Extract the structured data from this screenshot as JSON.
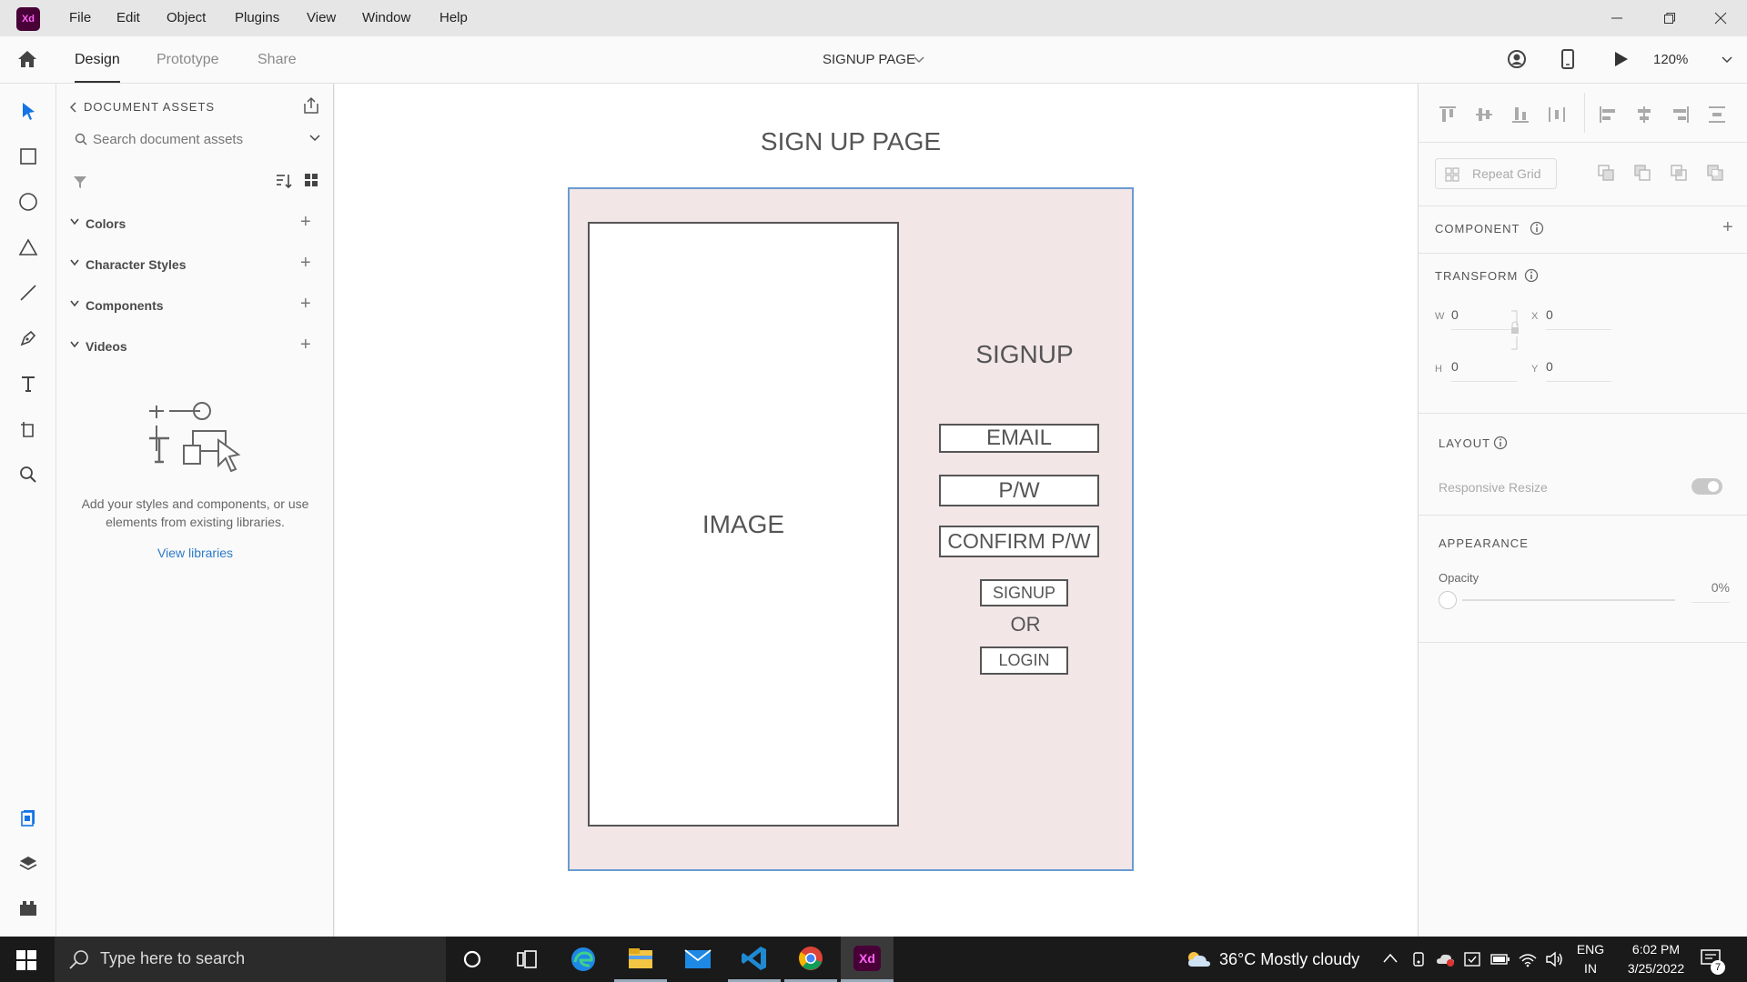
{
  "menu": [
    "File",
    "Edit",
    "Object",
    "Plugins",
    "View",
    "Window",
    "Help"
  ],
  "app_logo": "Xd",
  "tabs": [
    "Design",
    "Prototype",
    "Share"
  ],
  "document_title": "SIGNUP PAGE",
  "zoom": "120%",
  "assets": {
    "header": "DOCUMENT ASSETS",
    "search_placeholder": "Search document assets",
    "sections": [
      "Colors",
      "Character Styles",
      "Components",
      "Videos"
    ],
    "empty_text": "Add your styles and components, or use elements from existing libraries.",
    "view_libraries": "View libraries"
  },
  "canvas": {
    "artboard_title": "SIGN UP PAGE",
    "image_label": "IMAGE",
    "heading": "SIGNUP",
    "fields": [
      "EMAIL",
      "P/W",
      "CONFIRM P/W"
    ],
    "signup_button": "SIGNUP",
    "or_text": "OR",
    "login_button": "LOGIN"
  },
  "props": {
    "repeat_grid": "Repeat Grid",
    "component": "COMPONENT",
    "transform": "TRANSFORM",
    "w_label": "W",
    "w_value": "0",
    "x_label": "X",
    "x_value": "0",
    "h_label": "H",
    "h_value": "0",
    "y_label": "Y",
    "y_value": "0",
    "layout": "LAYOUT",
    "responsive_resize": "Responsive Resize",
    "appearance": "APPEARANCE",
    "opacity_label": "Opacity",
    "opacity_value": "0%"
  },
  "taskbar": {
    "search_placeholder": "Type here to search",
    "weather": "36°C  Mostly cloudy",
    "lang_top": "ENG",
    "lang_bottom": "IN",
    "time": "6:02 PM",
    "date": "3/25/2022",
    "notification_count": "7"
  },
  "colors": {
    "artboard_fill": "#f2e6e6",
    "artboard_border": "#6b9bd2",
    "link": "#2d7ac8",
    "xd_brand": "#470137"
  }
}
